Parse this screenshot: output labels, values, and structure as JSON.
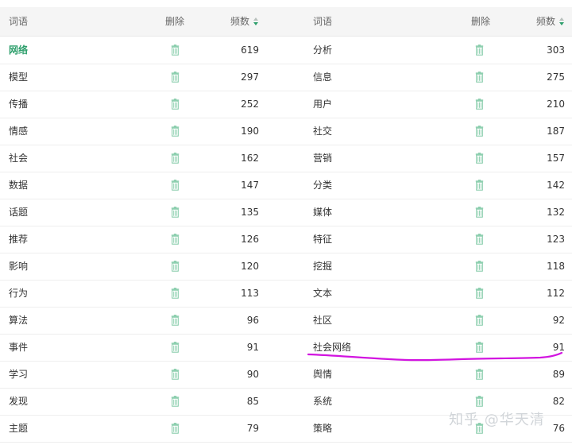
{
  "header": {
    "word_left": "词语",
    "delete_left": "删除",
    "freq_left": "频数",
    "word_right": "词语",
    "delete_right": "删除",
    "freq_right": "频数"
  },
  "rows": [
    {
      "left_word": "网络",
      "left_count": "619",
      "right_word": "分析",
      "right_count": "303",
      "left_highlight": true
    },
    {
      "left_word": "模型",
      "left_count": "297",
      "right_word": "信息",
      "right_count": "275"
    },
    {
      "left_word": "传播",
      "left_count": "252",
      "right_word": "用户",
      "right_count": "210"
    },
    {
      "left_word": "情感",
      "left_count": "190",
      "right_word": "社交",
      "right_count": "187"
    },
    {
      "left_word": "社会",
      "left_count": "162",
      "right_word": "营销",
      "right_count": "157"
    },
    {
      "left_word": "数据",
      "left_count": "147",
      "right_word": "分类",
      "right_count": "142"
    },
    {
      "left_word": "话题",
      "left_count": "135",
      "right_word": "媒体",
      "right_count": "132"
    },
    {
      "left_word": "推荐",
      "left_count": "126",
      "right_word": "特征",
      "right_count": "123"
    },
    {
      "left_word": "影响",
      "left_count": "120",
      "right_word": "挖掘",
      "right_count": "118"
    },
    {
      "left_word": "行为",
      "left_count": "113",
      "right_word": "文本",
      "right_count": "112"
    },
    {
      "left_word": "算法",
      "left_count": "96",
      "right_word": "社区",
      "right_count": "92"
    },
    {
      "left_word": "事件",
      "left_count": "91",
      "right_word": "社会网络",
      "right_count": "91"
    },
    {
      "left_word": "学习",
      "left_count": "90",
      "right_word": "舆情",
      "right_count": "89"
    },
    {
      "left_word": "发现",
      "left_count": "85",
      "right_word": "系统",
      "right_count": "82"
    },
    {
      "left_word": "主题",
      "left_count": "79",
      "right_word": "策略",
      "right_count": "76"
    }
  ],
  "icons": {
    "delete": "trash-icon",
    "sort": "sort-icon"
  },
  "colors": {
    "header_bg": "#f5f5f5",
    "row_border": "#eeeeee",
    "highlight": "#2e9f6c",
    "trash_icon": "#7fc9a5",
    "annotation": "#d214e0",
    "watermark": "#cfd3d7"
  },
  "watermark": "知乎 @华天清"
}
